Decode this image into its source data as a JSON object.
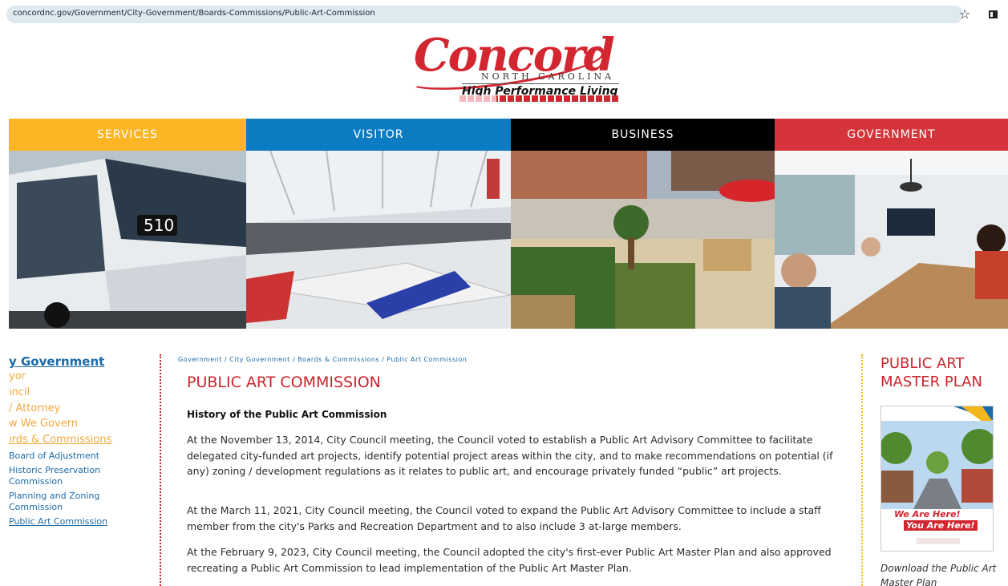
{
  "browser": {
    "url": "concordnc.gov/Government/City-Government/Boards-Commissions/Public-Art-Commission"
  },
  "logo": {
    "name": "Concord",
    "state": "NORTH CAROLINA",
    "tagline": "High Performance Living"
  },
  "nav": [
    {
      "label": "SERVICES",
      "color": "#fcb525"
    },
    {
      "label": "VISITOR",
      "color": "#0b7bc2"
    },
    {
      "label": "BUSINESS",
      "color": "#000000"
    },
    {
      "label": "GOVERNMENT",
      "color": "#d4343a"
    }
  ],
  "sidebar": {
    "title": "y Government",
    "links": [
      "yor",
      "ıncil",
      "/ Attorney",
      "w We Govern",
      "ırds & Commissions"
    ],
    "sublinks": [
      "Board of Adjustment",
      "Historic Preservation Commission",
      "Planning and Zoning Commission",
      "Public Art Commission"
    ]
  },
  "breadcrumb": "Government / City Government / Boards & Commissions / Public Art Commission",
  "page": {
    "title": "PUBLIC ART COMMISSION",
    "section_heading": "History of the Public Art Commission",
    "paragraphs": [
      "At the November 13, 2014, City Council meeting, the Council voted to establish a Public Art Advisory Committee to facilitate delegated city-funded art projects, identify potential project areas within the city, and to make recommendations on potential (if any) zoning / development regulations as it relates to public art, and encourage privately funded “public” art projects.",
      "At the March 11, 2021, City Council meeting, the Council voted to expand the Public Art Advisory Committee to include a staff member from the city's Parks and Recreation Department and to also include 3 at-large members.",
      "At the February 9, 2023, City Council meeting, the Council adopted the city's first-ever Public Art Master Plan and also approved recreating a Public Art Commission to lead implementation of the Public Art Master Plan."
    ]
  },
  "right": {
    "title": "PUBLIC ART MASTER PLAN",
    "cover_line1": "We Are Here!",
    "cover_line2": "You Are Here!",
    "caption": "Download the Public Art Master Plan"
  }
}
